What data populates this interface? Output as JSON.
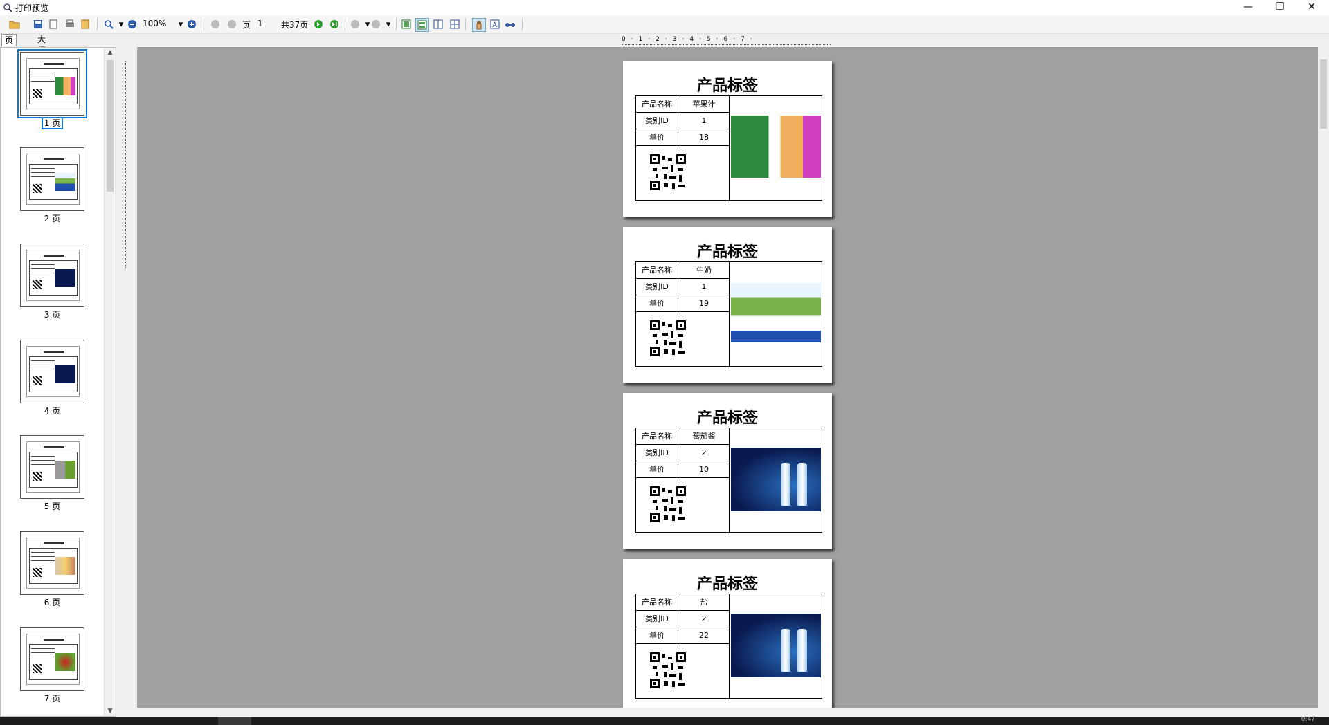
{
  "window": {
    "title": "打印预览",
    "minimize": "—",
    "restore": "❐",
    "close": "✕"
  },
  "toolbar": {
    "zoom": "100%",
    "page_label": "页",
    "page_number": "1",
    "total_pages": "共37页"
  },
  "tabs": [
    {
      "label": "页面"
    },
    {
      "label": "大纲"
    }
  ],
  "thumbnails": [
    {
      "label": "1 页",
      "image": "juice"
    },
    {
      "label": "2 页",
      "image": "milk"
    },
    {
      "label": "3 页",
      "image": "water"
    },
    {
      "label": "4 页",
      "image": "water"
    },
    {
      "label": "5 页",
      "image": "clothes"
    },
    {
      "label": "6 页",
      "image": "kids"
    },
    {
      "label": "7 页",
      "image": "vegetables"
    }
  ],
  "ruler": {
    "marks": "0·1·2·3·4·5·6·7·"
  },
  "labels": [
    {
      "title": "产品标签",
      "rows": [
        {
          "key": "产品名称",
          "value": "苹果汁"
        },
        {
          "key": "类别ID",
          "value": "1"
        },
        {
          "key": "单价",
          "value": "18"
        }
      ],
      "image": "juice"
    },
    {
      "title": "产品标签",
      "rows": [
        {
          "key": "产品名称",
          "value": "牛奶"
        },
        {
          "key": "类别ID",
          "value": "1"
        },
        {
          "key": "单价",
          "value": "19"
        }
      ],
      "image": "milk"
    },
    {
      "title": "产品标签",
      "rows": [
        {
          "key": "产品名称",
          "value": "蕃茄酱"
        },
        {
          "key": "类别ID",
          "value": "2"
        },
        {
          "key": "单价",
          "value": "10"
        }
      ],
      "image": "water"
    },
    {
      "title": "产品标签",
      "rows": [
        {
          "key": "产品名称",
          "value": "盐"
        },
        {
          "key": "类别ID",
          "value": "2"
        },
        {
          "key": "单价",
          "value": "22"
        }
      ],
      "image": "water"
    }
  ],
  "status": {
    "right_text": "0:47"
  }
}
